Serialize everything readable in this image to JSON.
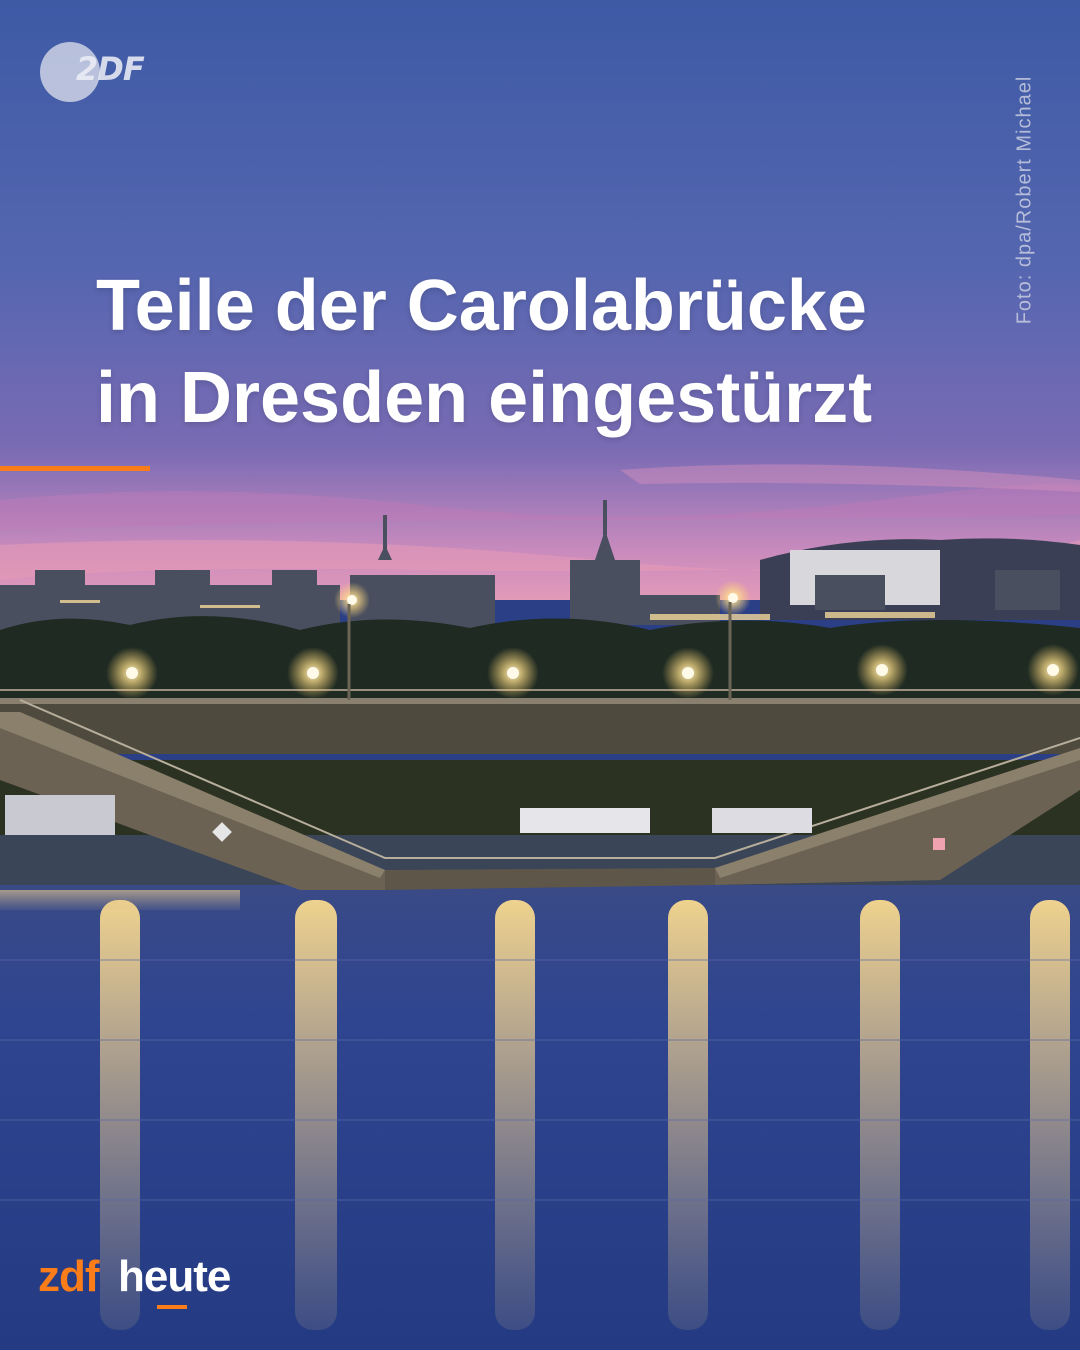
{
  "photo": {
    "subject": "collapsed bridge over river at dusk",
    "colors": {
      "sky_top": "#3f5aa3",
      "sky_mid": "#5d6bb0",
      "sky_horizon": "#d58bb4",
      "water": "#2b3f86",
      "light": "#f7d58a"
    }
  },
  "channel_logo": {
    "text": "2DF",
    "icon": "zdf-logo-icon"
  },
  "credit": "Foto: dpa/Robert Michael",
  "headline": {
    "line1": "Teile der Carolabrücke",
    "line2": "in Dresden eingestürzt"
  },
  "accent_color": "#fa7d19",
  "brand": {
    "part1": "zdf",
    "part2": "heute"
  }
}
